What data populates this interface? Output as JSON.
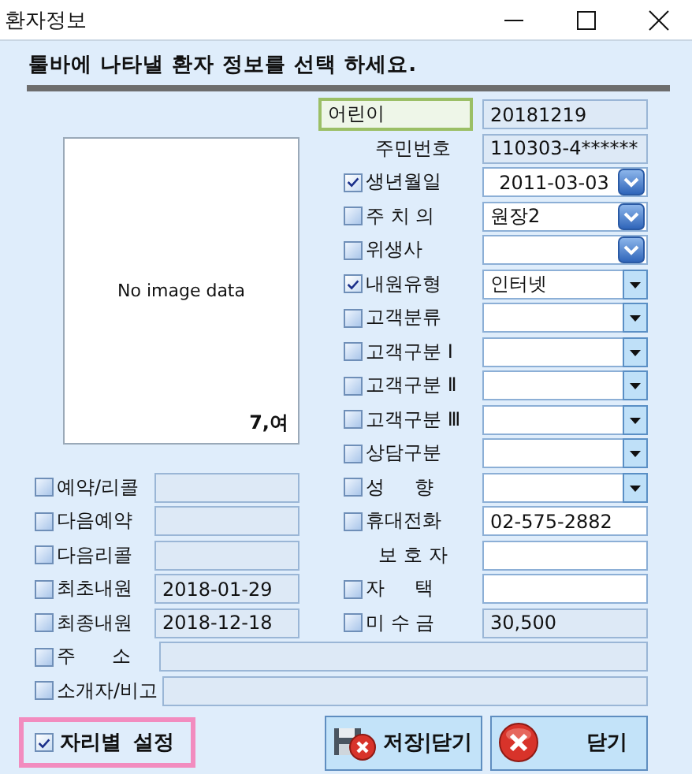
{
  "window": {
    "title": "환자정보"
  },
  "header": "툴바에 나타낼 환자 정보를 선택 하세요.",
  "photo": {
    "placeholder": "No image data",
    "caption": "7,여"
  },
  "right_rows": [
    {
      "kind": "badge",
      "label": "어린이",
      "field": {
        "kind": "readonly",
        "value": "20181219"
      }
    },
    {
      "kind": "plain",
      "label": "주민번호",
      "field": {
        "kind": "readonly",
        "value": "110303-4******"
      }
    },
    {
      "kind": "check",
      "checked": true,
      "label": "생년월일",
      "field": {
        "kind": "date",
        "value": "2011-03-03"
      }
    },
    {
      "kind": "check",
      "checked": false,
      "label": "주 치 의",
      "field": {
        "kind": "combo",
        "value": "원장2"
      }
    },
    {
      "kind": "check",
      "checked": false,
      "label": "위생사",
      "field": {
        "kind": "combo"
      }
    },
    {
      "kind": "check",
      "checked": true,
      "label": "내원유형",
      "field": {
        "kind": "dropdown",
        "value": "인터넷"
      }
    },
    {
      "kind": "check",
      "checked": false,
      "label": "고객분류",
      "field": {
        "kind": "dropdown"
      }
    },
    {
      "kind": "check",
      "checked": false,
      "label": "고객구분 Ⅰ",
      "field": {
        "kind": "dropdown"
      }
    },
    {
      "kind": "check",
      "checked": false,
      "label": "고객구분 Ⅱ",
      "field": {
        "kind": "dropdown"
      }
    },
    {
      "kind": "check",
      "checked": false,
      "label": "고객구분 Ⅲ",
      "field": {
        "kind": "dropdown"
      }
    },
    {
      "kind": "check",
      "checked": false,
      "label": "상담구분",
      "field": {
        "kind": "dropdown"
      }
    },
    {
      "kind": "check",
      "checked": false,
      "label": "성     향",
      "field": {
        "kind": "dropdown"
      }
    },
    {
      "kind": "check",
      "checked": false,
      "label": "휴대전화",
      "field": {
        "kind": "text",
        "value": "02-575-2882"
      }
    },
    {
      "kind": "plain",
      "label": "보 호 자",
      "field": {
        "kind": "text"
      }
    },
    {
      "kind": "check",
      "checked": false,
      "label": "자     택",
      "field": {
        "kind": "text"
      }
    },
    {
      "kind": "check",
      "checked": false,
      "label": "미 수 금",
      "field": {
        "kind": "readonly",
        "value": "30,500"
      }
    }
  ],
  "left_rows": [
    {
      "checked": false,
      "label": "예약/리콜"
    },
    {
      "checked": false,
      "label": "다음예약"
    },
    {
      "checked": false,
      "label": "다음리콜"
    },
    {
      "checked": false,
      "label": "최초내원",
      "value": "2018-01-29"
    },
    {
      "checked": false,
      "label": "최종내원",
      "value": "2018-12-18"
    }
  ],
  "wide_rows": [
    {
      "checked": false,
      "label": "주      소"
    },
    {
      "checked": false,
      "label": "소개자/비고"
    }
  ],
  "seat_setting": {
    "checked": true,
    "label": "자리별 설정"
  },
  "buttons": [
    {
      "kind": "save-close",
      "label": "저장|닫기"
    },
    {
      "kind": "close",
      "label": "닫기"
    }
  ]
}
